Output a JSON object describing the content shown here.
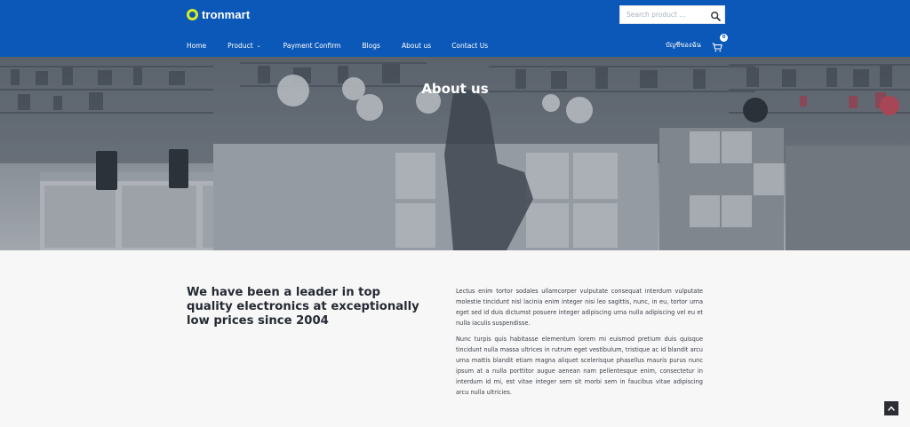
{
  "brand": {
    "name": "tronmart"
  },
  "search": {
    "placeholder": "Search product ...",
    "value": "",
    "icon": "search-icon"
  },
  "nav": {
    "items": [
      {
        "label": "Home"
      },
      {
        "label": "Product",
        "has_submenu": true
      },
      {
        "label": "Payment Confirm"
      },
      {
        "label": "Blogs"
      },
      {
        "label": "About us"
      },
      {
        "label": "Contact Us"
      }
    ],
    "account_label": "บัญชีของฉัน",
    "cart_count": "0"
  },
  "hero": {
    "title": "About us"
  },
  "content": {
    "lead": "We have been a leader in top quality electronics at exceptionally low prices since 2004",
    "paragraphs": [
      "Lectus enim tortor sodales ullamcorper vulputate consequat interdum vulputate molestie tincidunt nisl lacinia enim integer nisi leo sagittis, nunc, in eu, tortor urna eget sed id duis dictumst posuere integer adipiscing urna nulla adipiscing vel eu et nulla iaculis suspendisse.",
      "Nunc turpis quis habitasse elementum lorem mi euismod pretium duis quisque tincidunt nulla massa ultrices in rutrum eget vestibulum, tristique ac id blandit arcu urna mattis blandit etiam magna aliquet scelerisque phasellus mauris purus nunc ipsum at a nulla porttitor augue aenean nam pellentesque enim, consectetur in interdum id mi, est vitae integer sem sit morbi sem in faucibus vitae adipiscing arcu nulla ultricies."
    ]
  },
  "colors": {
    "header": "#0c58b8",
    "logo_accent": "#d7ee23",
    "page_background": "#f7f7f7",
    "back_to_top": "#2b2f33"
  }
}
